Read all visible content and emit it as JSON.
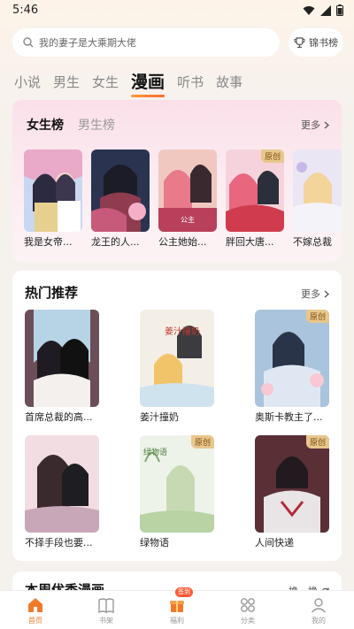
{
  "status": {
    "time": "5:46"
  },
  "search": {
    "placeholder": "我的妻子是大乘期大佬",
    "rank_label": "锦书榜"
  },
  "tabs": [
    "小说",
    "男生",
    "女生",
    "漫画",
    "听书",
    "故事"
  ],
  "active_tab": "漫画",
  "rank_section": {
    "tabs": [
      "女生榜",
      "男生榜"
    ],
    "more": "更多",
    "items": [
      {
        "title": "我是女帝...",
        "badge": ""
      },
      {
        "title": "龙王的人...",
        "badge": ""
      },
      {
        "title": "公主她始...",
        "badge": ""
      },
      {
        "title": "胖回大唐...",
        "badge": "原创"
      },
      {
        "title": "不嫁总裁",
        "badge": ""
      }
    ]
  },
  "hot_section": {
    "title": "热门推荐",
    "more": "更多",
    "items": [
      {
        "title": "首席总裁的高...",
        "badge": ""
      },
      {
        "title": "姜汁撞奶",
        "badge": "",
        "cover_text": "姜汁撞奶"
      },
      {
        "title": "奥斯卡教主了...",
        "badge": "原创"
      },
      {
        "title": "不择手段也要...",
        "badge": ""
      },
      {
        "title": "绿物语",
        "badge": "原创",
        "cover_text": "绿物语"
      },
      {
        "title": "人间快递",
        "badge": "原创"
      }
    ]
  },
  "week_section": {
    "title": "本周优秀漫画",
    "action": "换一换"
  },
  "bottom_nav": [
    {
      "label": "首页",
      "icon": "home-icon",
      "active": true
    },
    {
      "label": "书架",
      "icon": "book-icon",
      "active": false
    },
    {
      "label": "福利",
      "icon": "gift-icon",
      "active": false,
      "badge": "签到"
    },
    {
      "label": "分类",
      "icon": "grid-icon",
      "active": false
    },
    {
      "label": "我的",
      "icon": "user-icon",
      "active": false
    }
  ],
  "colors": {
    "accent": "#f07a2c",
    "badge_bg": "#e8c78d",
    "rank_bg": "#fbe0ea"
  }
}
